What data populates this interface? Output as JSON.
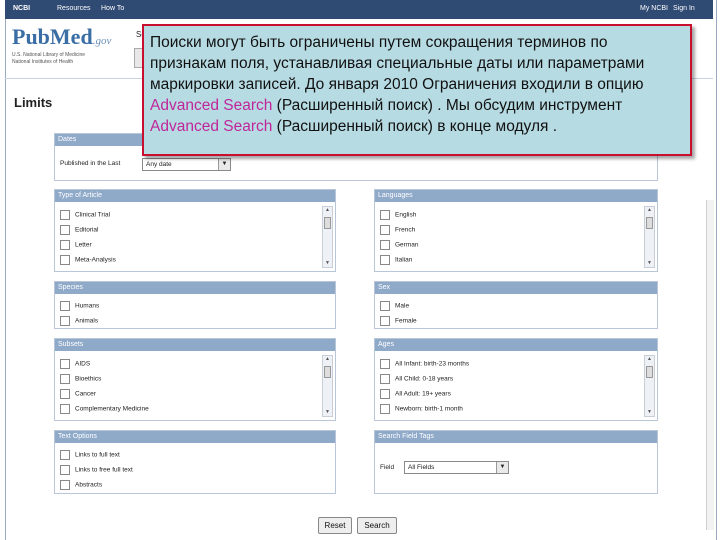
{
  "ncbi": {
    "logo": "NCBI",
    "resources": "Resources",
    "how_to": "How To",
    "my_ncbi": "My NCBI",
    "sign_in": "Sign In"
  },
  "logo": {
    "pub": "Pub",
    "med": "Med",
    "gov": ".gov",
    "line1": "U.S. National Library of Medicine",
    "line2": "National Institutes of Health"
  },
  "search": {
    "label": "Se"
  },
  "page_title": "Limits",
  "dates": {
    "title": "Dates",
    "label": "Published in the Last",
    "value": "Any date"
  },
  "type_of_article": {
    "title": "Type of Article",
    "items": [
      "Clinical Trial",
      "Editorial",
      "Letter",
      "Meta-Analysis"
    ]
  },
  "languages": {
    "title": "Languages",
    "items": [
      "English",
      "French",
      "German",
      "Italian"
    ]
  },
  "species": {
    "title": "Species",
    "items": [
      "Humans",
      "Animals"
    ]
  },
  "sex": {
    "title": "Sex",
    "items": [
      "Male",
      "Female"
    ]
  },
  "subsets": {
    "title": "Subsets",
    "items": [
      "AIDS",
      "Bioethics",
      "Cancer",
      "Complementary Medicine"
    ]
  },
  "ages": {
    "title": "Ages",
    "items": [
      "All Infant: birth-23 months",
      "All Child: 0-18 years",
      "All Adult: 19+ years",
      "Newborn: birth-1 month"
    ]
  },
  "text_options": {
    "title": "Text Options",
    "items": [
      "Links to full text",
      "Links to free full text",
      "Abstracts"
    ]
  },
  "search_field_tags": {
    "title": "Search Field Tags",
    "label": "Field",
    "value": "All Fields"
  },
  "buttons": {
    "reset": "Reset",
    "search": "Search"
  },
  "overlay": {
    "part1": "Поиски могут быть ограничены  путем сокращения терминов по признакам поля,  устанавливая специальные даты или параметрами маркировки записей.  До января  2010 Ограничения входили в опцию ",
    "hl1": "Advanced Search",
    "part2": " (Расширенный поиск) .  Мы обсудим инструмент  ",
    "hl2": "Advanced Search",
    "part3": " (Расширенный поиск) в конце модуля ."
  },
  "colors": {
    "accent_header": "#8fa9c9",
    "ncbi_bar": "#2f4a73",
    "overlay_bg": "#b6dbe3",
    "overlay_border": "#c8102e",
    "highlight": "#c0269a"
  }
}
